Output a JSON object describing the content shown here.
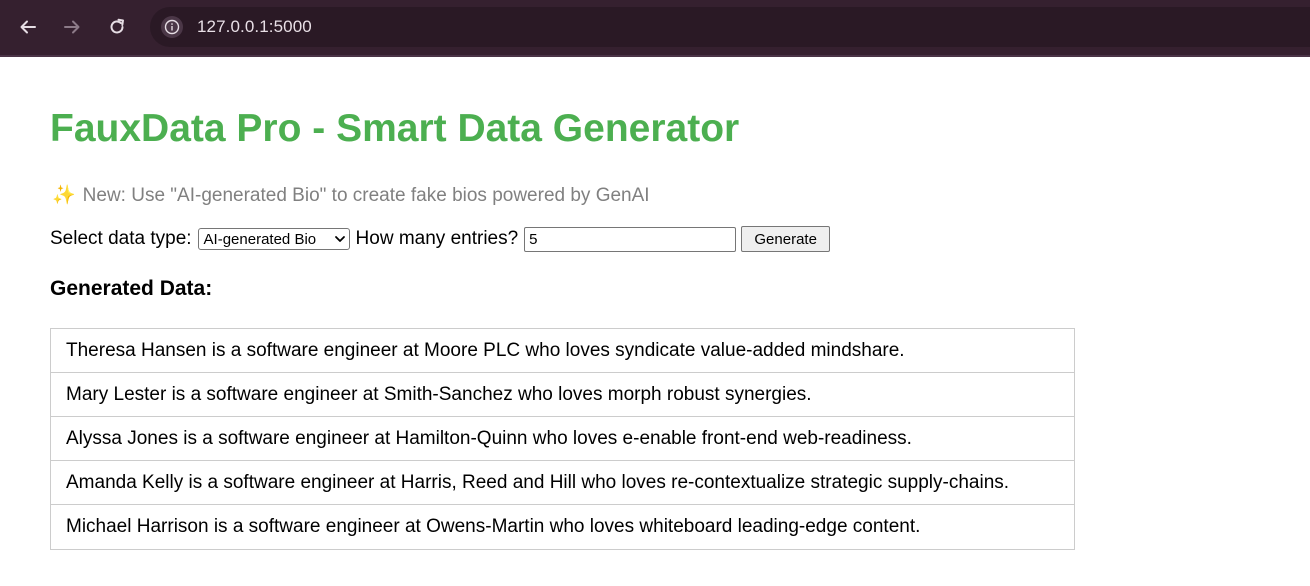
{
  "browser": {
    "url": "127.0.0.1:5000"
  },
  "page": {
    "title": "FauxData Pro - Smart Data Generator",
    "notice_icon": "✨",
    "notice_text": "New: Use \"AI-generated Bio\" to create fake bios powered by GenAI"
  },
  "form": {
    "type_label": "Select data type:",
    "type_selected": "AI-generated Bio",
    "count_label": "How many entries?",
    "count_value": "5",
    "generate_label": "Generate"
  },
  "results": {
    "heading": "Generated Data:",
    "items": [
      "Theresa Hansen is a software engineer at Moore PLC who loves syndicate value-added mindshare.",
      "Mary Lester is a software engineer at Smith-Sanchez who loves morph robust synergies.",
      "Alyssa Jones is a software engineer at Hamilton-Quinn who loves e-enable front-end web-readiness.",
      "Amanda Kelly is a software engineer at Harris, Reed and Hill who loves re-contextualize strategic supply-chains.",
      "Michael Harrison is a software engineer at Owens-Martin who loves whiteboard leading-edge content."
    ]
  },
  "colors": {
    "accent": "#4caf50",
    "browser_bar": "#35202f",
    "notice_text": "#808080"
  }
}
